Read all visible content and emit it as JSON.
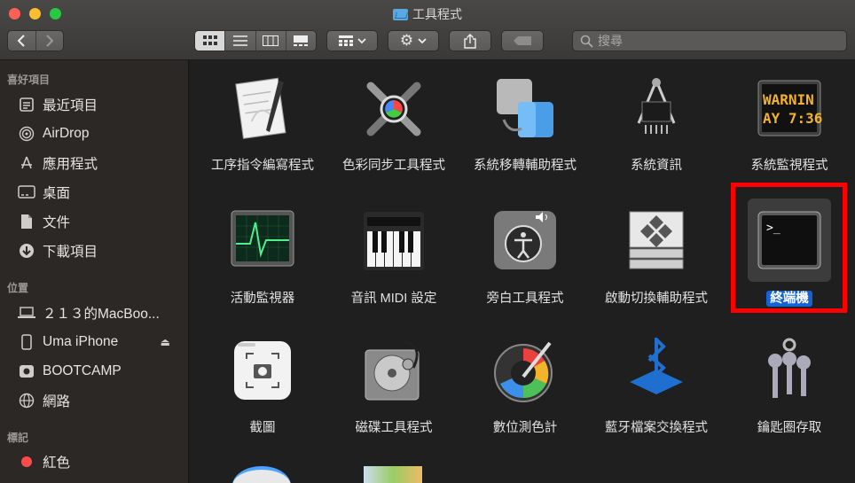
{
  "window": {
    "title": "工具程式"
  },
  "toolbar": {
    "search_placeholder": "搜尋",
    "back_icon": "chevron-left-icon",
    "forward_icon": "chevron-right-icon"
  },
  "sidebar": {
    "favorites_header": "喜好項目",
    "favorites": [
      {
        "label": "最近項目",
        "icon": "recents-icon"
      },
      {
        "label": "AirDrop",
        "icon": "airdrop-icon"
      },
      {
        "label": "應用程式",
        "icon": "applications-icon"
      },
      {
        "label": "桌面",
        "icon": "desktop-icon"
      },
      {
        "label": "文件",
        "icon": "documents-icon"
      },
      {
        "label": "下載項目",
        "icon": "downloads-icon"
      }
    ],
    "locations_header": "位置",
    "locations": [
      {
        "label": "２１３的MacBoo...",
        "icon": "laptop-icon"
      },
      {
        "label": "Uma iPhone",
        "icon": "iphone-icon"
      },
      {
        "label": "BOOTCAMP",
        "icon": "disk-icon"
      },
      {
        "label": "網路",
        "icon": "network-icon"
      }
    ],
    "tags_header": "標記",
    "tags": [
      {
        "label": "紅色",
        "color": "#ff4b4b"
      }
    ]
  },
  "apps": [
    {
      "label": "工序指令編寫程式"
    },
    {
      "label": "色彩同步工具程式"
    },
    {
      "label": "系統移轉輔助程式"
    },
    {
      "label": "系統資訊"
    },
    {
      "label": "系統監視程式",
      "icon_text": [
        "WARNIN",
        "AY 7:36"
      ]
    },
    {
      "label": "活動監視器"
    },
    {
      "label": "音訊 MIDI 設定"
    },
    {
      "label": "旁白工具程式"
    },
    {
      "label": "啟動切換輔助程式"
    },
    {
      "label": "終端機",
      "selected": true,
      "icon_text": ">_"
    },
    {
      "label": "截圖"
    },
    {
      "label": "磁碟工具程式"
    },
    {
      "label": "數位測色計"
    },
    {
      "label": "藍牙檔案交換程式"
    },
    {
      "label": "鑰匙圈存取"
    }
  ],
  "colors": {
    "selection": "#1463d6",
    "highlight": "#ff0000"
  }
}
